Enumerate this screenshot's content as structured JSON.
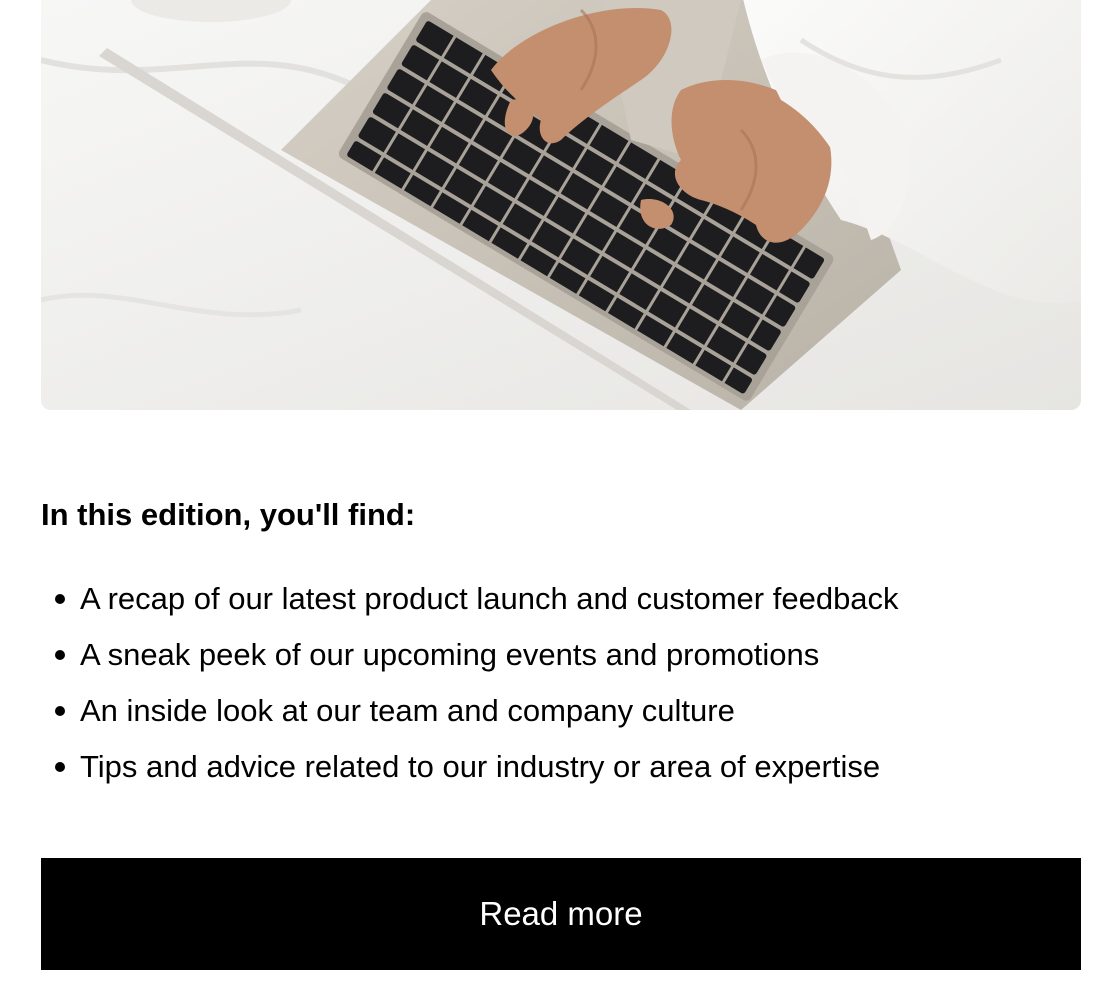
{
  "hero_image": {
    "alt": "Hands typing on a laptop keyboard on white bed sheets",
    "colors": {
      "sheets": "#f2f1ef",
      "laptop": "#c9c3ba",
      "keys": "#1d1d1f",
      "skin": "#c48f6e"
    }
  },
  "section": {
    "heading": "In this edition, you'll find:",
    "items": [
      "A recap of our latest product launch and customer feedback",
      "A sneak peek of our upcoming events and promotions",
      "An inside look at our team and company culture",
      "Tips and advice related to our industry or area of expertise"
    ]
  },
  "cta": {
    "label": "Read more",
    "background": "#000000",
    "text_color": "#ffffff"
  }
}
